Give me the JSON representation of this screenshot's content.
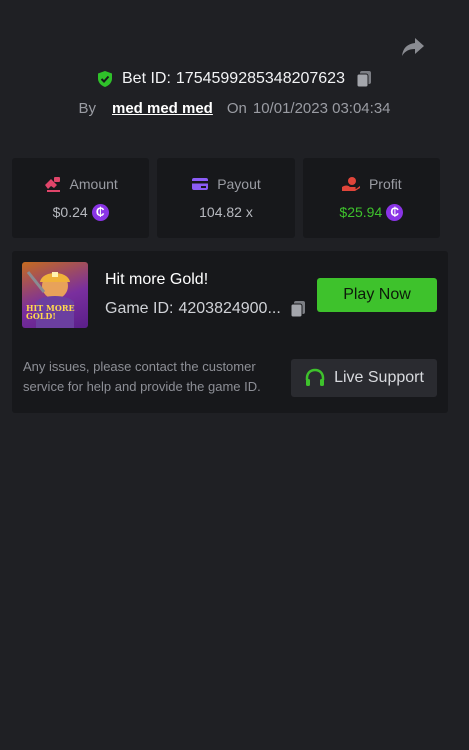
{
  "bet": {
    "id_label": "Bet ID:",
    "id_value": "1754599285348207623",
    "by_label": "By",
    "user": "med med med",
    "on_label": "On",
    "datetime": "10/01/2023 03:04:34"
  },
  "stats": {
    "amount": {
      "label": "Amount",
      "value": "$0.24"
    },
    "payout": {
      "label": "Payout",
      "value": "104.82 x"
    },
    "profit": {
      "label": "Profit",
      "value": "$25.94"
    }
  },
  "game": {
    "title": "Hit more Gold!",
    "thumb_text": "HIT MORE GOLD!",
    "id_label": "Game ID:",
    "id_value": "4203824900...",
    "play_label": "Play Now"
  },
  "support": {
    "text": "Any issues, please contact the customer service for help and provide the game ID.",
    "button_label": "Live Support"
  },
  "colors": {
    "background": "#1f2024",
    "card": "#17181b",
    "accent_green": "#3ec22c",
    "coin_purple": "#8a34e6",
    "amount_icon": "#e0456a",
    "payout_icon": "#8b5cf6",
    "profit_icon": "#e0453a"
  },
  "icons": {
    "share": "share-icon",
    "shield": "verified-shield-icon",
    "copy": "copy-icon",
    "amount": "bet-amount-icon",
    "payout": "card-icon",
    "profit": "profit-hand-icon",
    "coin": "coin-icon",
    "headset": "headset-icon"
  }
}
